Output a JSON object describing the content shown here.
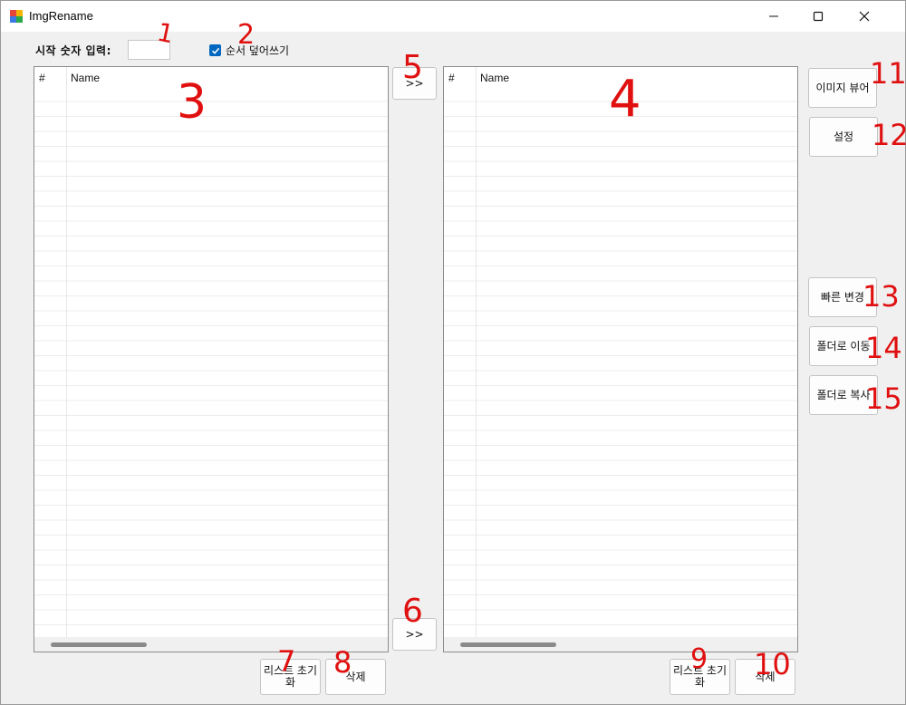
{
  "window": {
    "title": "ImgRename"
  },
  "top": {
    "start_number_label": "시작 숫자 입력:",
    "start_number_value": "",
    "overwrite_checkbox_label": "순서 덮어쓰기",
    "overwrite_checked": true
  },
  "left_list": {
    "columns": [
      "#",
      "Name"
    ],
    "rows": []
  },
  "right_list": {
    "columns": [
      "#",
      "Name"
    ],
    "rows": []
  },
  "buttons": {
    "move_top": ">>",
    "move_bottom": ">>",
    "image_viewer": "이미지 뷰어",
    "settings": "설정",
    "quick_change": "빠른 변경",
    "move_to_folder": "폴더로 이동",
    "copy_to_folder": "폴더로 복사",
    "left_reset": "리스트 초기화",
    "left_delete": "삭제",
    "right_reset": "리스트 초기화",
    "right_delete": "삭제"
  },
  "annotations": [
    "1",
    "2",
    "3",
    "4",
    "5",
    "6",
    "7",
    "8",
    "9",
    "10",
    "11",
    "12",
    "13",
    "14",
    "15"
  ],
  "colors": {
    "annotation": "#e01010",
    "checkbox_accent": "#0067c0"
  }
}
